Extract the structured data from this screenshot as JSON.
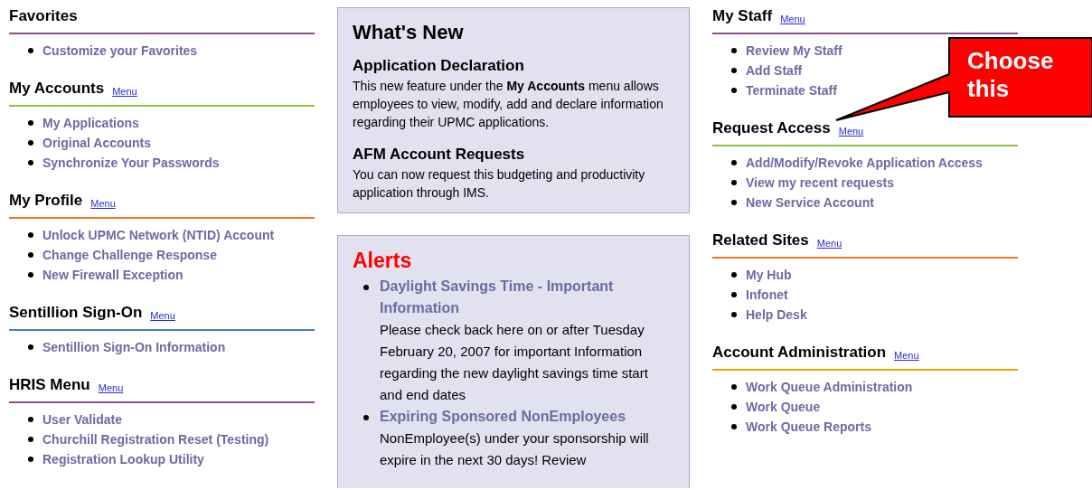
{
  "left_sections": [
    {
      "title": "Favorites",
      "color": "#8e4f8e",
      "items": [
        "Customize your Favorites"
      ]
    },
    {
      "title": "My Accounts",
      "menu": "Menu",
      "color": "#94c044",
      "items": [
        "My Applications",
        "Original Accounts",
        "Synchronize Your Passwords"
      ]
    },
    {
      "title": "My Profile",
      "menu": "Menu",
      "color": "#e87722",
      "items": [
        "Unlock UPMC Network (NTID) Account",
        "Change Challenge Response",
        "New Firewall Exception"
      ]
    },
    {
      "title": "Sentillion Sign-On",
      "menu": "Menu",
      "color": "#4a7ec0",
      "items": [
        "Sentillion Sign-On Information"
      ]
    },
    {
      "title": "HRIS Menu",
      "menu": "Menu",
      "color": "#8e4f8e",
      "items": [
        "User Validate",
        "Churchill Registration Reset (Testing)",
        "Registration Lookup Utility"
      ]
    }
  ],
  "whats_new": {
    "title": "What's New",
    "entries": [
      {
        "heading": "Application Declaration",
        "text": "This new feature under the **My Accounts** menu allows employees to view, modify, add and declare information regarding their UPMC applications."
      },
      {
        "heading": "AFM Account Requests",
        "text": "You can now request this budgeting and productivity application through IMS."
      }
    ]
  },
  "alerts": {
    "title": "Alerts",
    "items": [
      {
        "link": "Daylight Savings Time - Important Information",
        "text": "Please check back here on or after Tuesday February 20, 2007 for important Information regarding the new daylight savings time start and end dates"
      },
      {
        "link": "Expiring Sponsored NonEmployees",
        "text": "NonEmployee(s) under your sponsorship will expire in the next 30 days! Review"
      }
    ]
  },
  "right_sections": [
    {
      "title": "My Staff",
      "menu": "Menu",
      "color": "#8e4f8e",
      "items": [
        "Review My Staff",
        "Add Staff",
        "Terminate Staff"
      ]
    },
    {
      "title": "Request Access",
      "menu": "Menu",
      "color": "#94c044",
      "items": [
        "Add/Modify/Revoke Application Access",
        "View my recent requests",
        "New Service Account"
      ]
    },
    {
      "title": "Related Sites",
      "menu": "Menu",
      "color": "#e87722",
      "items": [
        "My Hub",
        "Infonet",
        "Help Desk"
      ]
    },
    {
      "title": "Account Administration",
      "menu": "Menu",
      "color": "#e0a800",
      "items": [
        "Work Queue Administration",
        "Work Queue",
        "Work Queue Reports"
      ]
    }
  ],
  "callout": {
    "text": "Choose this"
  }
}
